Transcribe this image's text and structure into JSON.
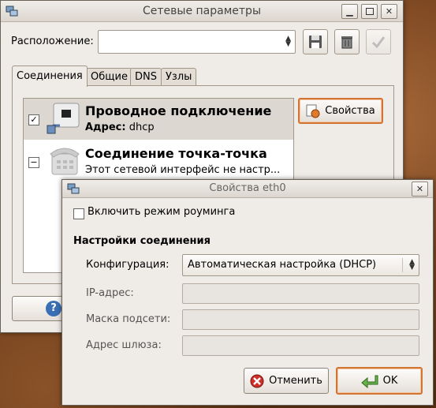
{
  "main_window": {
    "title": "Сетевые параметры",
    "location_label": "Расположение:",
    "location_value": "",
    "tabs": [
      {
        "label": "Соединения"
      },
      {
        "label": "Общие"
      },
      {
        "label": "DNS"
      },
      {
        "label": "Узлы"
      }
    ],
    "connections": [
      {
        "title": "Проводное подключение",
        "detail_key": "Адрес:",
        "detail_value": "dhcp",
        "enabled": true
      },
      {
        "title": "Соединение точка-точка",
        "detail_value": "Этот сетевой интерфейс не настр...",
        "enabled": false
      }
    ],
    "properties_button": "Свойства",
    "help_button": "?"
  },
  "dialog": {
    "title": "Свойства eth0",
    "roaming_label": "Включить режим роуминга",
    "roaming_checked": false,
    "section_title": "Настройки соединения",
    "config_label": "Конфигурация:",
    "config_value": "Автоматическая настройка (DHCP)",
    "ip_label": "IP-адрес:",
    "ip_value": "",
    "mask_label": "Маска подсети:",
    "mask_value": "",
    "gateway_label": "Адрес шлюза:",
    "gateway_value": "",
    "cancel_button": "Отменить",
    "ok_button": "OK"
  }
}
